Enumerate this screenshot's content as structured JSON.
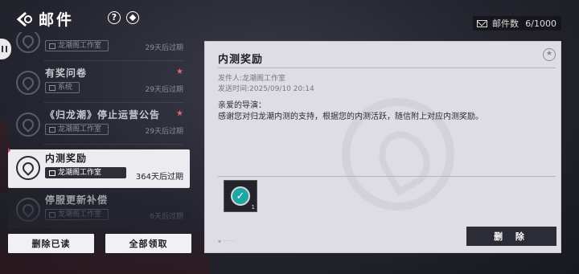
{
  "header": {
    "title": "邮件",
    "help_glyph": "?"
  },
  "mail_count": {
    "label": "邮件数",
    "value": "6/1000"
  },
  "mails": [
    {
      "title": "",
      "sender": "龙潮阁工作室",
      "expire": "29天后过期",
      "starred": false
    },
    {
      "title": "有奖问卷",
      "sender": "系统",
      "expire": "29天后过期",
      "starred": true
    },
    {
      "title": "《归龙潮》停止运营公告",
      "sender": "龙潮阁工作室",
      "expire": "29天后过期",
      "starred": true
    },
    {
      "title": "内测奖励",
      "sender": "龙潮阁工作室",
      "expire": "364天后过期",
      "starred": false,
      "selected": true
    },
    {
      "title": "停服更新补偿",
      "sender": "龙潮阁工作室",
      "expire": "6天后过期",
      "starred": false
    }
  ],
  "buttons": {
    "delete_read": "删除已读",
    "claim_all": "全部领取",
    "delete": "删 除"
  },
  "detail": {
    "title": "内测奖励",
    "sender": "发件人:龙潮阁工作室",
    "time": "发送时间:2025/09/10 20:14",
    "greeting": "亲爱的导演：",
    "body": "感谢您对归龙潮内测的支持，根据您的内测活跃，随信附上对应内测奖励。",
    "attachment_qty": "1"
  },
  "icons": {
    "back": "back-arrow-icon",
    "help": "help-icon",
    "diamond": "diamond-icon",
    "envelope": "envelope-icon",
    "star": "star-icon"
  },
  "colors": {
    "accent_red": "#c64452",
    "attachment_teal": "#1fa7a6",
    "panel_bg": "#dedde3",
    "dark_button": "#2c2c36"
  }
}
